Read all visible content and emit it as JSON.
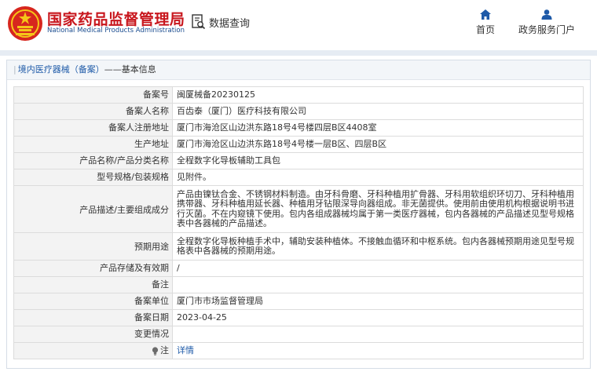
{
  "header": {
    "logo_cn": "国家药品监督管理局",
    "logo_en": "National Medical Products Administration",
    "data_query": "数据查询",
    "nav": [
      {
        "label": "首页",
        "icon": "home-icon"
      },
      {
        "label": "政务服务门户",
        "icon": "user-icon"
      }
    ]
  },
  "panel": {
    "title_part1": "境内医疗器械（备案）",
    "title_part2": "——基本信息"
  },
  "fields": [
    {
      "label": "备案号",
      "value": "闽厦械备20230125"
    },
    {
      "label": "备案人名称",
      "value": "百齿泰（厦门）医疗科技有限公司"
    },
    {
      "label": "备案人注册地址",
      "value": "厦门市海沧区山边洪东路18号4号楼四层B区4408室"
    },
    {
      "label": "生产地址",
      "value": "厦门市海沧区山边洪东路18号4号楼一层B区、四层B区"
    },
    {
      "label": "产品名称/产品分类名称",
      "value": "全程数字化导板辅助工具包"
    },
    {
      "label": "型号规格/包装规格",
      "value": "见附件。"
    },
    {
      "label": "产品描述/主要组成成分",
      "value": "产品由镍钛合金、不锈钢材料制造。由牙科骨磨、牙科种植用扩骨器、牙科用软组织环切刀、牙科种植用携带器、牙科种植用延长器、种植用牙钻限深导向器组成。非无菌提供。使用前由使用机构根据说明书进行灭菌。不在内窥镜下使用。包内各组成器械均属于第一类医疗器械，包内各器械的产品描述见型号规格表中各器械的产品描述。"
    },
    {
      "label": "预期用途",
      "value": "全程数字化导板种植手术中，辅助安装种植体。不接触血循环和中枢系统。包内各器械预期用途见型号规格表中各器械的预期用途。"
    },
    {
      "label": "产品存储及有效期",
      "value": "/"
    },
    {
      "label": "备注",
      "value": ""
    },
    {
      "label": "备案单位",
      "value": "厦门市市场监督管理局"
    },
    {
      "label": "备案日期",
      "value": "2023-04-25"
    },
    {
      "label": "变更情况",
      "value": ""
    },
    {
      "label": "注",
      "value": "详情",
      "icon": "lightbulb-icon"
    }
  ],
  "colors": {
    "brand_red": "#c8161d",
    "brand_blue": "#1e5aa8",
    "label_bg": "#f3f3f3"
  }
}
